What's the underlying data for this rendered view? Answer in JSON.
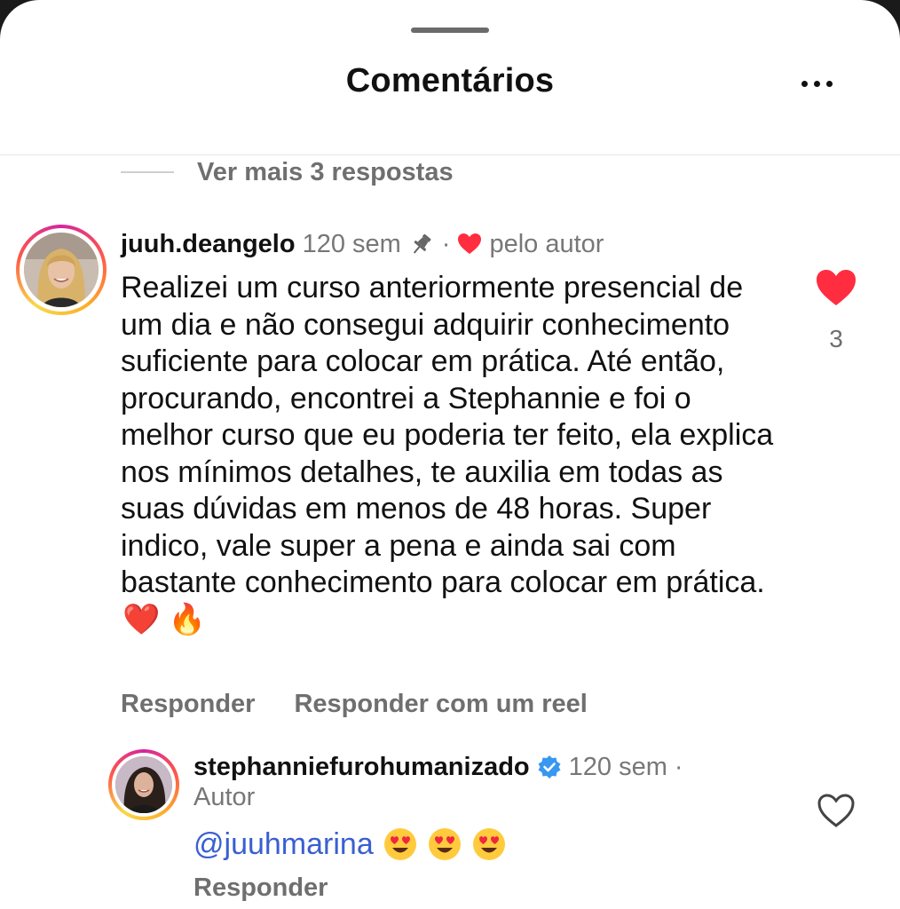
{
  "header": {
    "title": "Comentários",
    "more_icon": "more-horizontal-icon"
  },
  "thread": {
    "view_more_replies": "Ver mais 3 respostas"
  },
  "comment": {
    "username": "juuh.deangelo",
    "time": "120 sem",
    "separator": "·",
    "pinned": true,
    "liked_by_author_label": "pelo autor",
    "text": "Realizei um curso anteriormente presencial de um dia e não consegui adquirir conhecimento suficiente para colocar em prática. Até então, procurando, encontrei a Stephannie e foi o melhor curso que eu poderia ter feito, ela explica nos mínimos detalhes, te auxilia em todas as suas dúvidas em menos de 48 horas. Super indico, vale super a pena e ainda sai com bastante conhecimento para colocar em prática.",
    "text_emojis": [
      "❤️",
      "🔥"
    ],
    "liked": true,
    "like_count": "3",
    "reply_label": "Responder",
    "reply_reel_label": "Responder com um reel"
  },
  "reply": {
    "username": "stephanniefurohumanizado",
    "verified": true,
    "time": "120 sem",
    "separator": "·",
    "author_label": "Autor",
    "mention": "@juuhmarina",
    "emojis": [
      "😍",
      "😍",
      "😍"
    ],
    "liked": false,
    "reply_label": "Responder"
  },
  "colors": {
    "like_red": "#ff2d3f",
    "mention_blue": "#3a5fd0",
    "verified_blue": "#3897f0",
    "muted_text": "#6f6f6f"
  }
}
